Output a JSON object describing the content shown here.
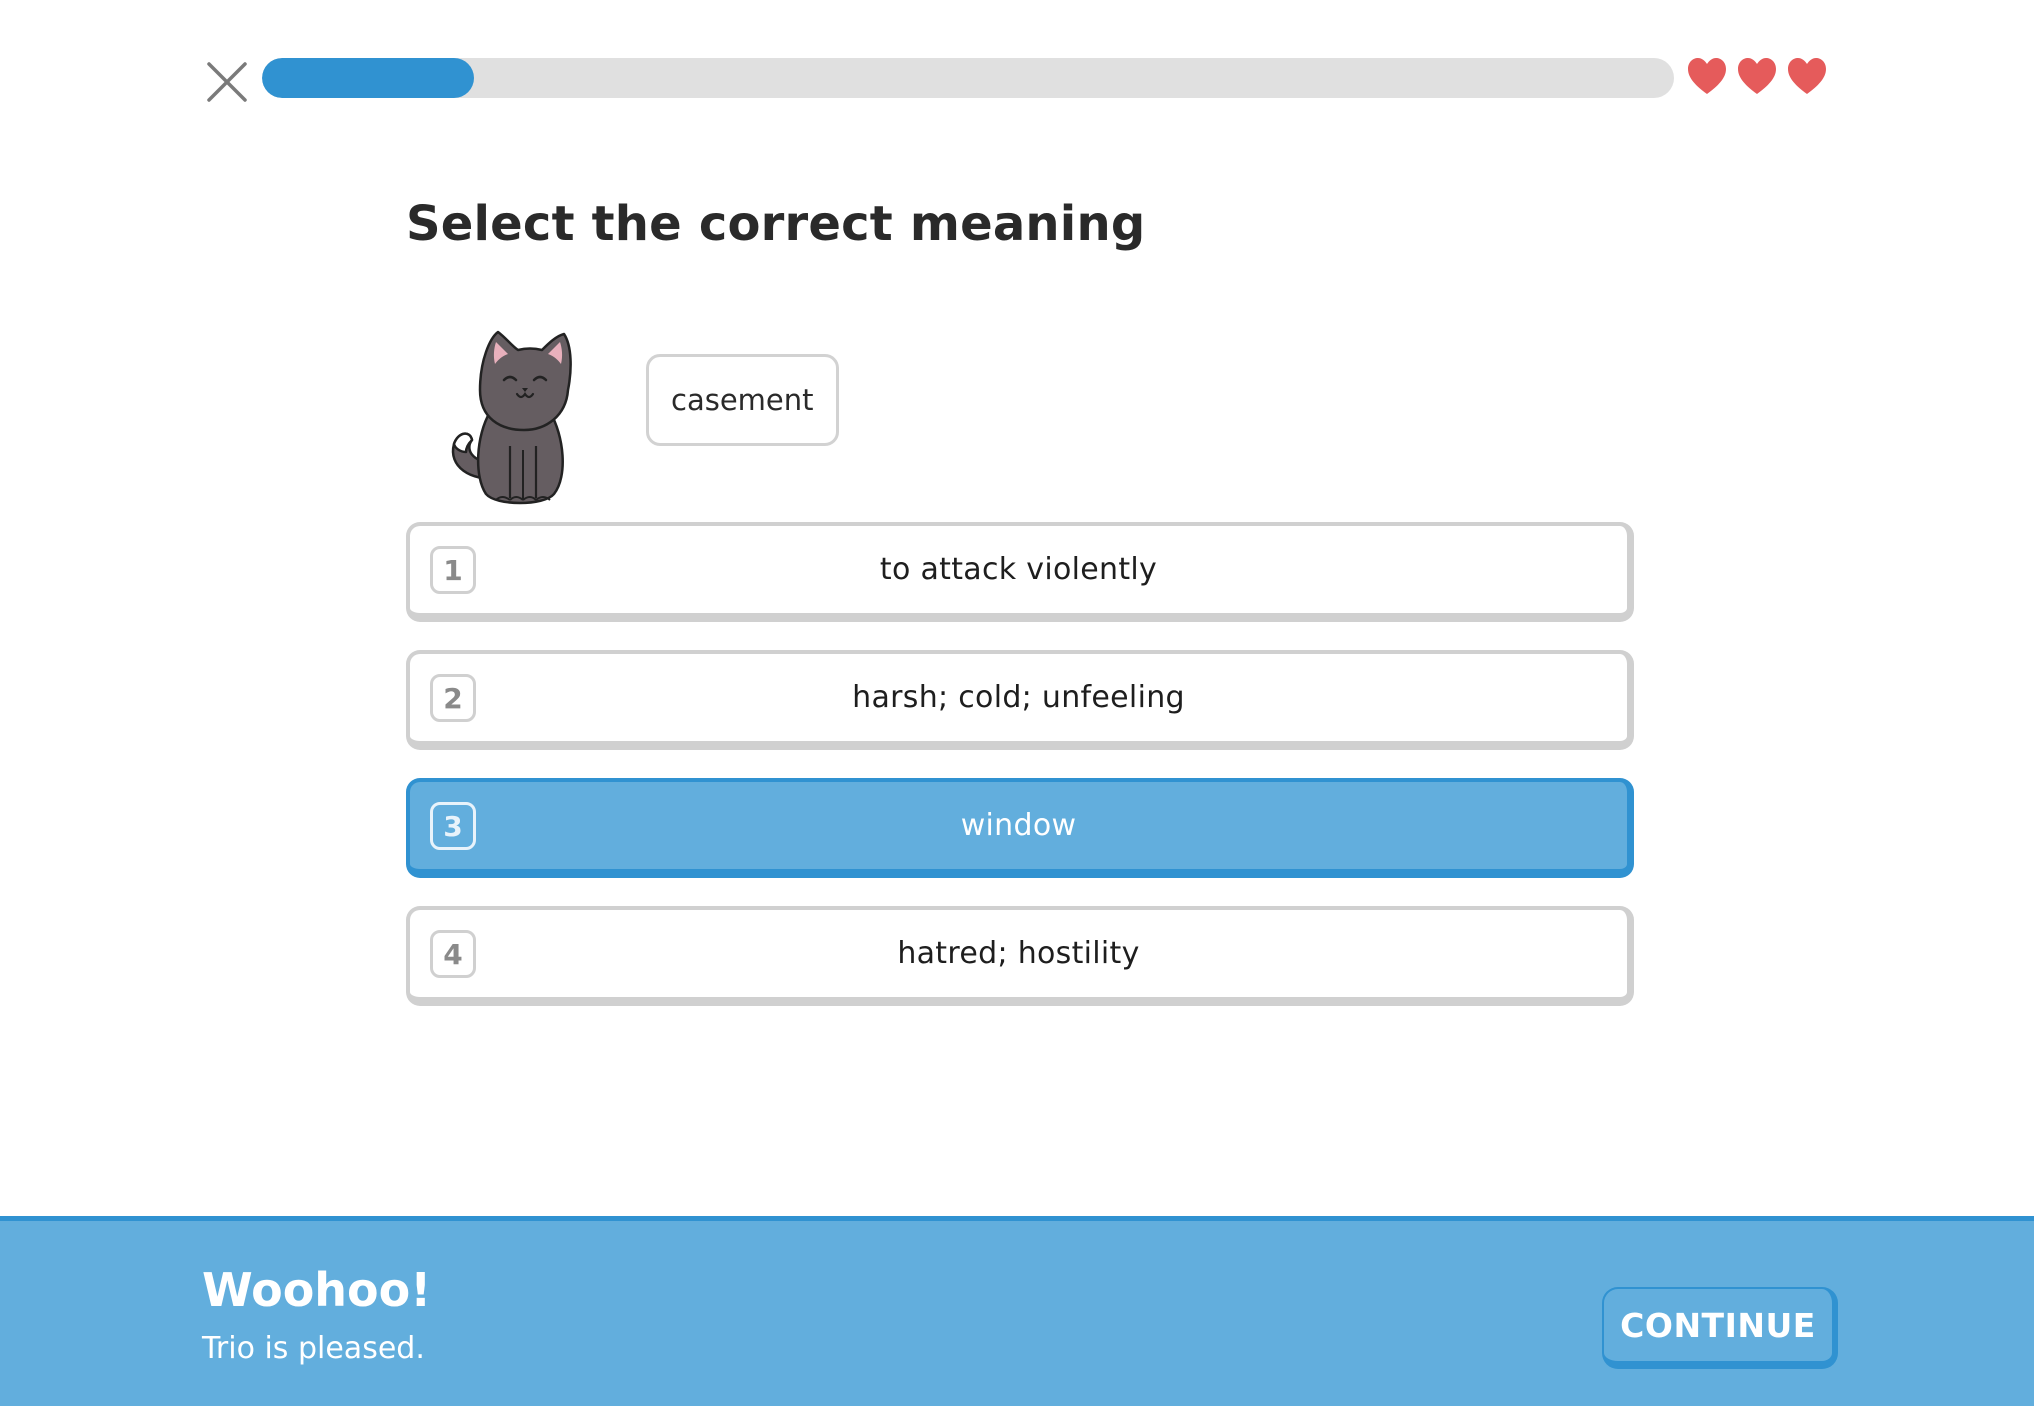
{
  "header": {
    "close_icon": "close-icon",
    "progress": 0.15,
    "lives": 3,
    "heart_icon": "heart-icon",
    "colors": {
      "progress_fill": "#3092d1",
      "progress_track": "#e0e0e0",
      "heart": "#e55b5b"
    }
  },
  "prompt": {
    "title": "Select the correct meaning",
    "character_icon": "cat-icon",
    "word": "casement"
  },
  "choices": [
    {
      "number": "1",
      "text": "to attack violently",
      "selected": false
    },
    {
      "number": "2",
      "text": "harsh; cold; unfeeling",
      "selected": false
    },
    {
      "number": "3",
      "text": "window",
      "selected": true
    },
    {
      "number": "4",
      "text": "hatred; hostility",
      "selected": false
    }
  ],
  "feedback": {
    "title": "Woohoo!",
    "message": "Trio is pleased.",
    "button_label": "CONTINUE",
    "colors": {
      "background": "#62aedd",
      "accent": "#3092d1"
    }
  }
}
